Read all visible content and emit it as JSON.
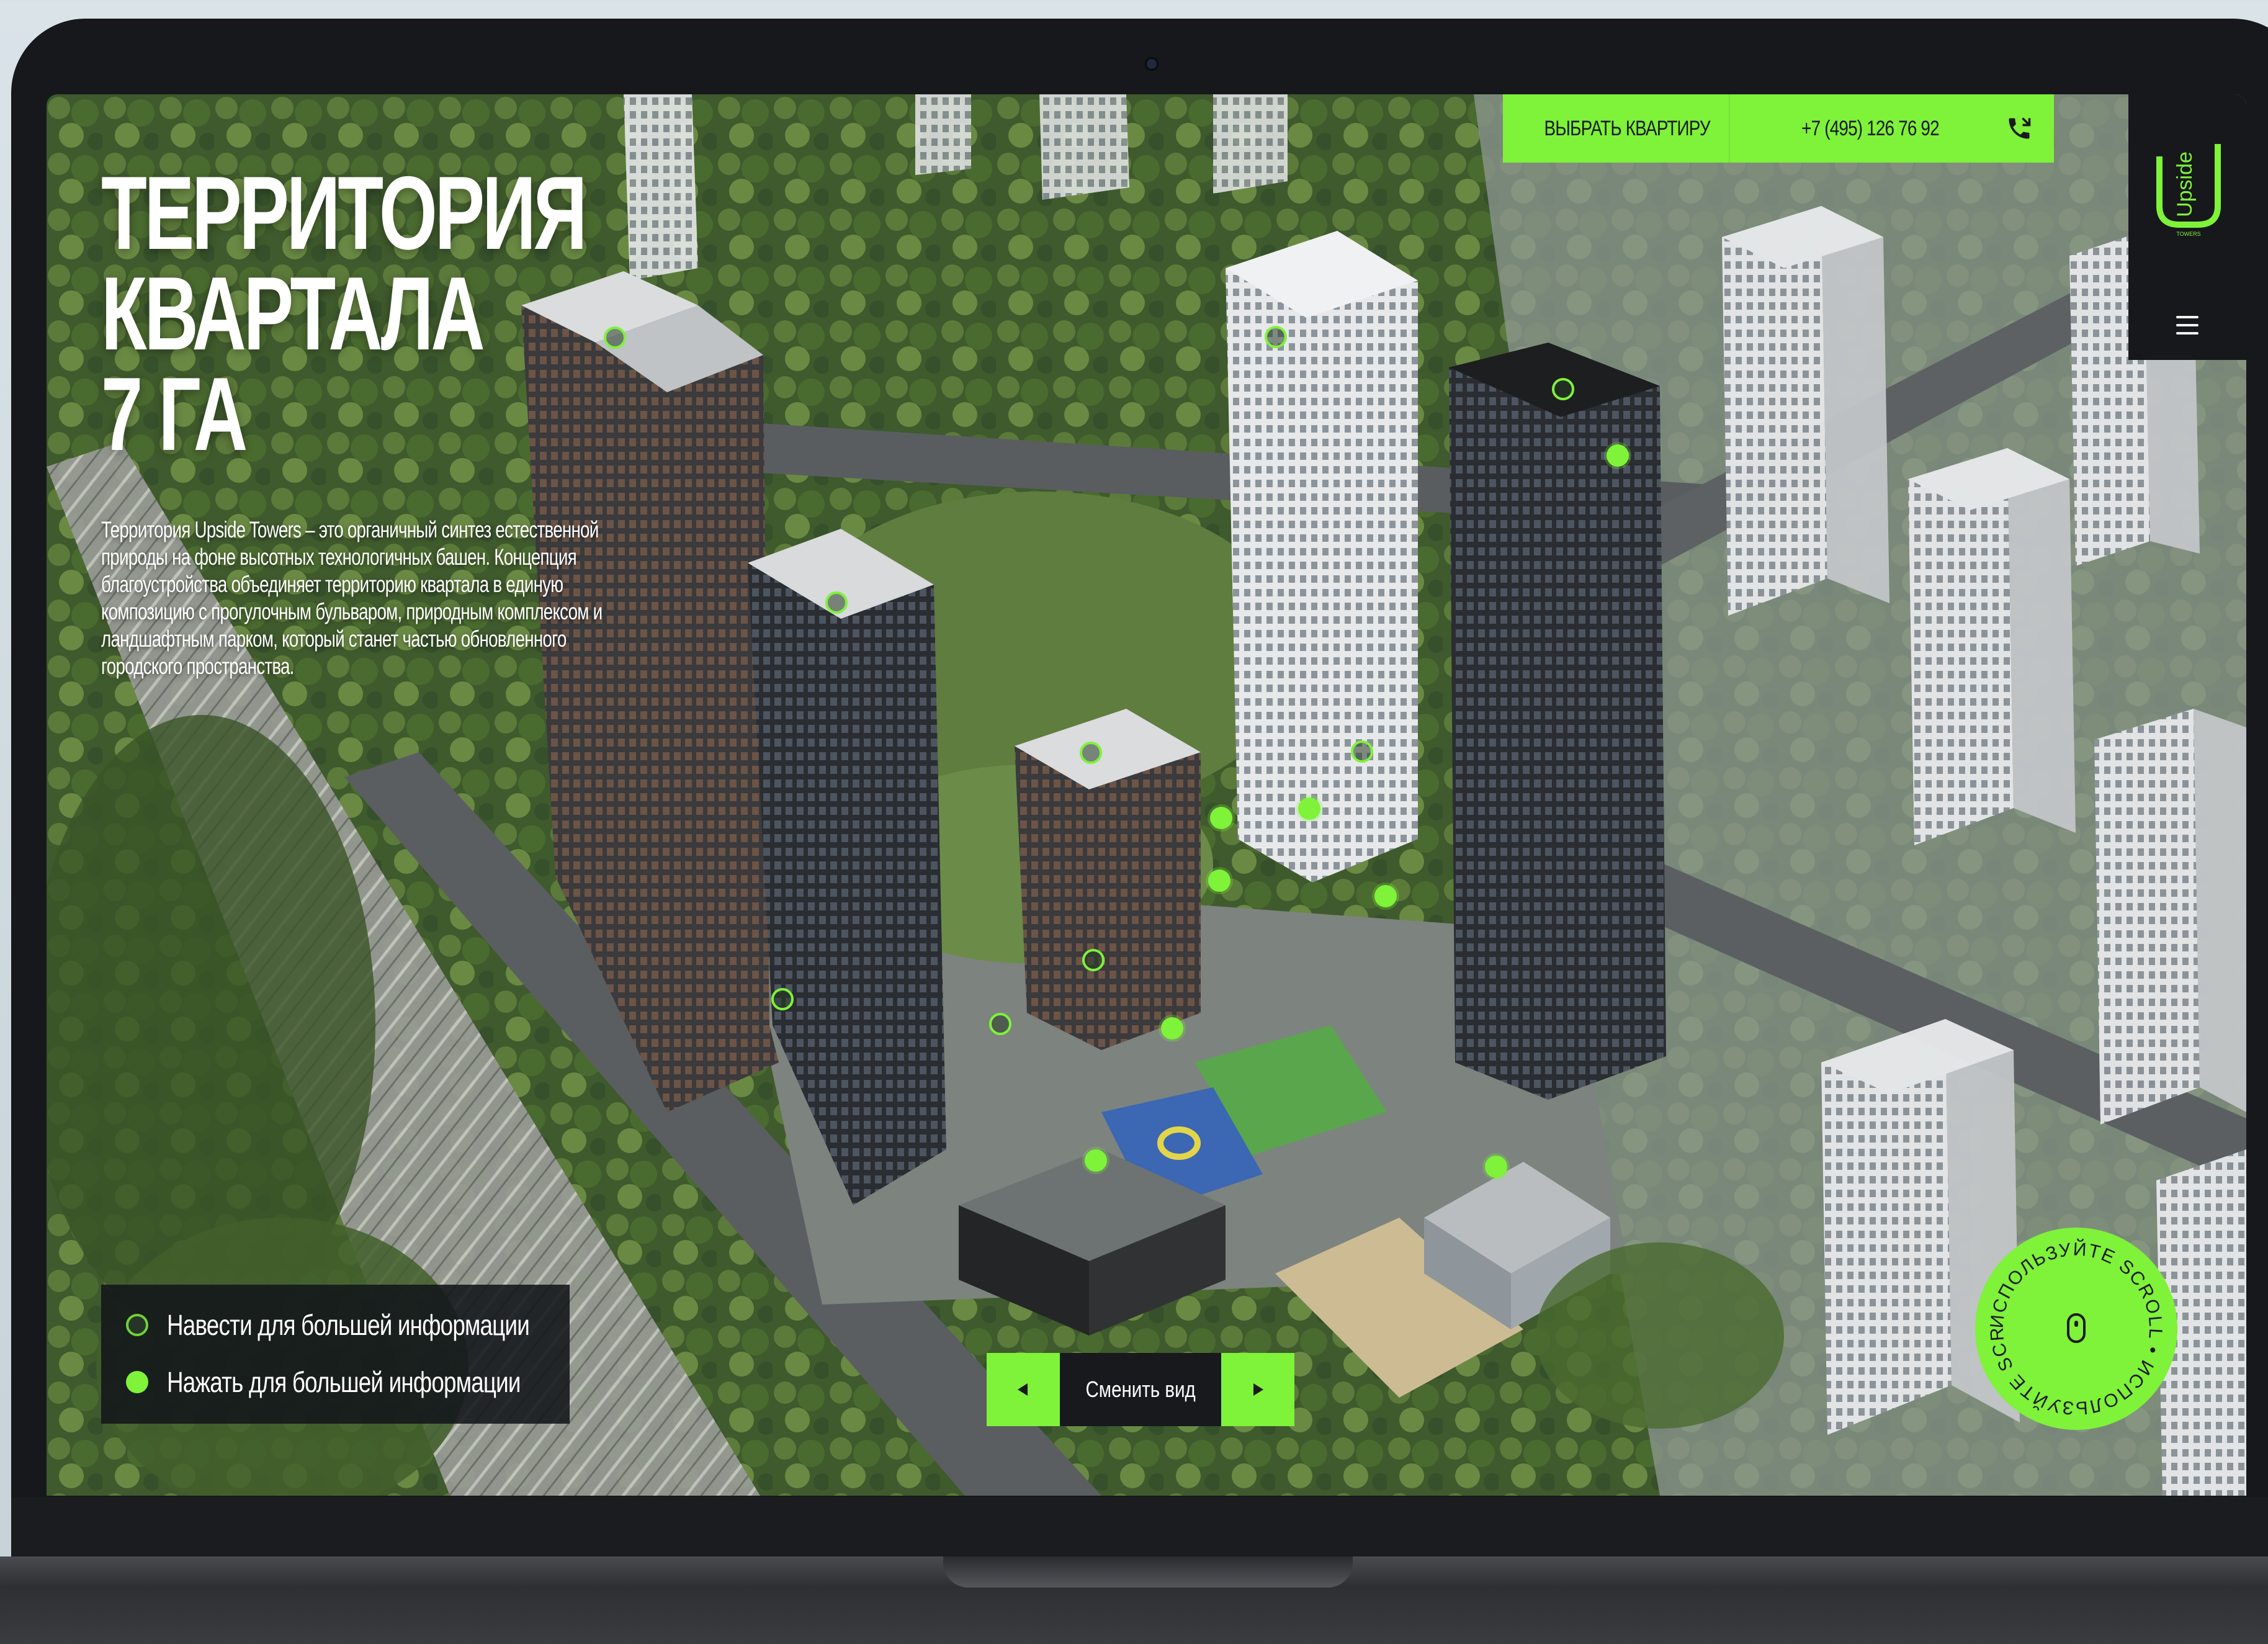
{
  "header": {
    "choose_apartment": "ВЫБРАТЬ КВАРТИРУ",
    "phone": "+7 (495) 126 76 92",
    "phone_icon": "phone-icon",
    "accent_color": "#7ff23a"
  },
  "logo": {
    "name": "Upside",
    "tagline": "TOWERS"
  },
  "hero": {
    "title_lines": [
      "ТЕРРИТОРИЯ",
      "КВАРТАЛА",
      "7 ГА"
    ],
    "description": "Территория Upside Towers – это органичный синтез естественной природы на фоне высотных технологичных башен. Концепция благоустройства объединяет территорию квартала в единую композицию с прогулочным бульваром, природным комплексом и ландшафтным парком, который станет частью обновленного городского пространства."
  },
  "legend": {
    "hover_label": "Навести для большей информации",
    "click_label": "Нажать для большей информации"
  },
  "view_switch": {
    "label": "Сменить вид",
    "prev_icon": "triangle-left-icon",
    "next_icon": "triangle-right-icon"
  },
  "scroll_badge": {
    "ring_text": "ИСПОЛЬЗУЙТЕ SCROLL • ИСПОЛЬЗУЙТЕ SCROLL • ",
    "icon": "mouse-icon"
  },
  "menu": {
    "icon": "hamburger-icon"
  }
}
